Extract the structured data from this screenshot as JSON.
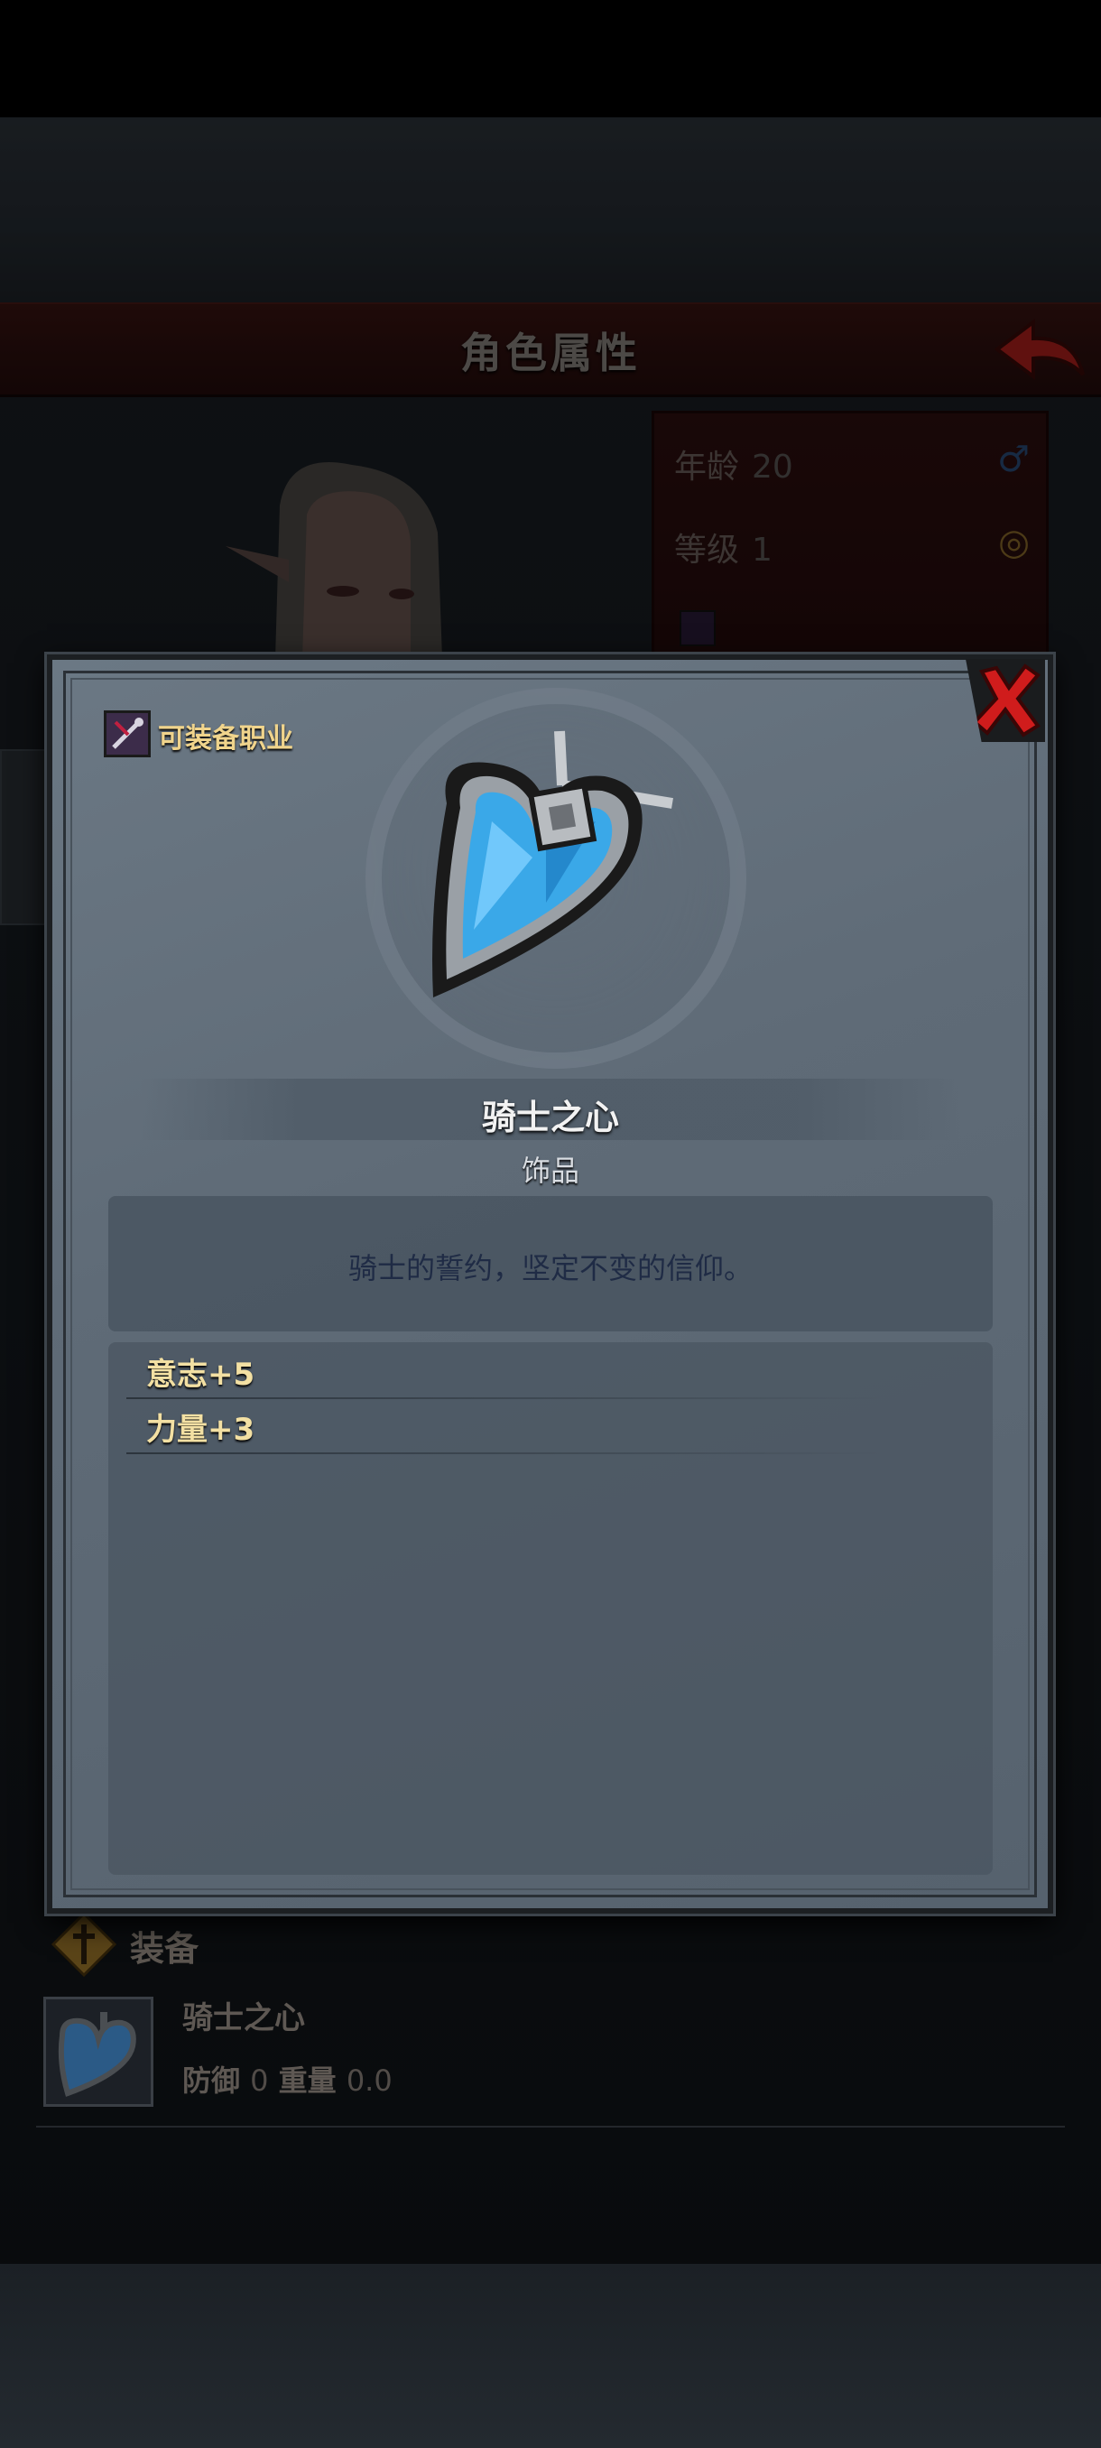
{
  "header": {
    "title": "角色属性"
  },
  "character_stats": {
    "age_label": "年龄",
    "age_value": "20",
    "level_label": "等级",
    "level_value": "1"
  },
  "modal": {
    "job_label": "可装备职业",
    "item_name": "骑士之心",
    "item_type": "饰品",
    "description": "骑士的誓约，坚定不变的信仰。",
    "attributes": [
      "意志+5",
      "力量+3"
    ]
  },
  "equipment": {
    "section_title": "装备",
    "item_name": "骑士之心",
    "defense_label": "防御",
    "defense_value": "0",
    "weight_label": "重量",
    "weight_value": "0.0"
  },
  "colors": {
    "header_red": "#2c0f0e",
    "modal_gray": "#5f6b77",
    "gold_text": "#f3e0a3",
    "desc_text": "#1f2b45",
    "close_red": "#d01c1c",
    "gem_blue": "#3aa8e8"
  }
}
